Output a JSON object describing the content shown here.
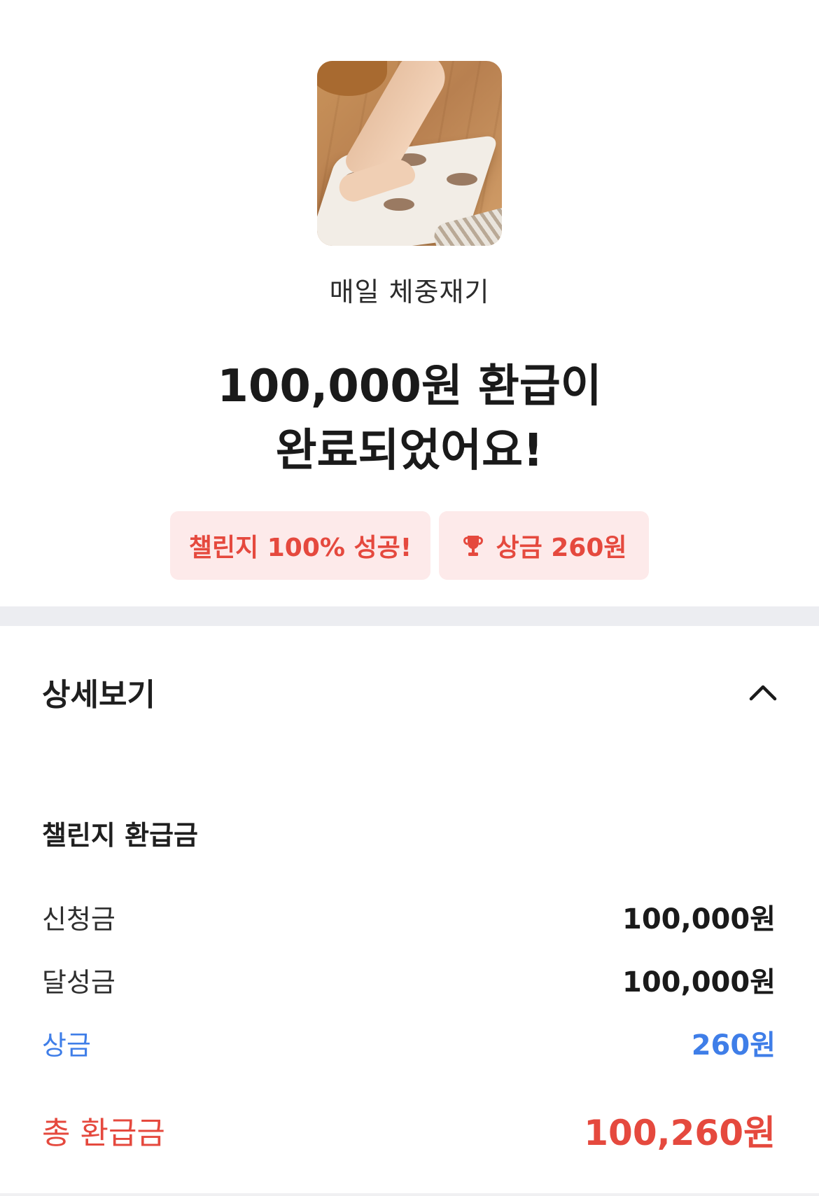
{
  "challenge": {
    "name": "매일 체중재기",
    "image_alt": "foot stepping on bathroom scale"
  },
  "headline": {
    "line1": "100,000원 환급이",
    "line2": "완료되었어요!"
  },
  "badges": {
    "success": "챌린지 100% 성공!",
    "prize": "상금 260원",
    "prize_icon": "trophy-icon"
  },
  "detail": {
    "header": "상세보기",
    "toggle_icon": "chevron-up-icon",
    "section_title": "챌린지 환급금",
    "rows": [
      {
        "label": "신청금",
        "value": "100,000원"
      },
      {
        "label": "달성금",
        "value": "100,000원"
      },
      {
        "label": "상금",
        "value": "260원"
      }
    ],
    "total": {
      "label": "총 환급금",
      "value": "100,260원"
    }
  },
  "colors": {
    "accent_red": "#e5493e",
    "badge_bg": "#fdeaea",
    "prize_blue": "#3f7ee8",
    "divider": "#ecedf1"
  }
}
